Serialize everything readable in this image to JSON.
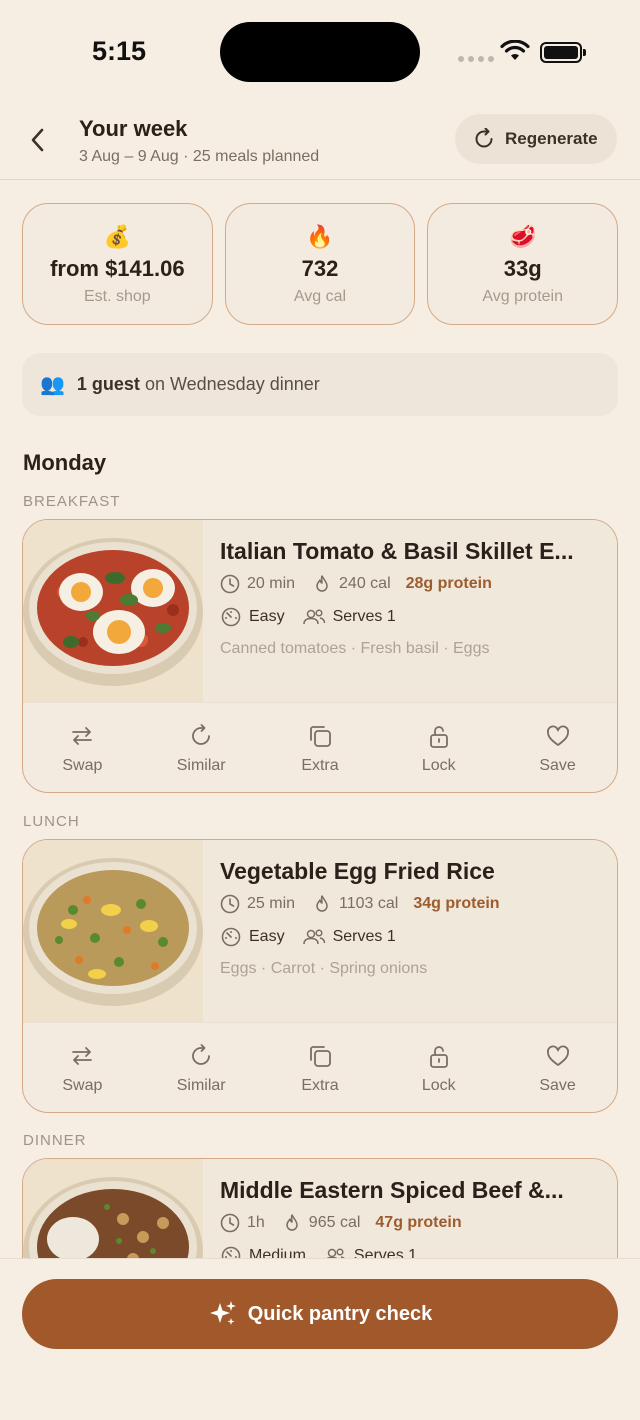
{
  "status": {
    "time": "5:15"
  },
  "header": {
    "title": "Your week",
    "subtitle": "3 Aug – 9 Aug · 25 meals planned",
    "regenerate_label": "Regenerate"
  },
  "stats": [
    {
      "icon": "💰",
      "value": "from $141.06",
      "label": "Est. shop"
    },
    {
      "icon": "🔥",
      "value": "732",
      "label": "Avg cal"
    },
    {
      "icon": "🥩",
      "value": "33g",
      "label": "Avg protein"
    }
  ],
  "guest": {
    "icon": "👥",
    "bold": "1 guest",
    "rest": "on Wednesday dinner"
  },
  "day": {
    "title": "Monday"
  },
  "meals": [
    {
      "section": "BREAKFAST",
      "name": "Italian Tomato & Basil Skillet E...",
      "time": "20 min",
      "cal": "240 cal",
      "protein": "28g protein",
      "difficulty": "Easy",
      "serves": "Serves 1",
      "ingredients": "Canned tomatoes · Fresh basil · Eggs"
    },
    {
      "section": "LUNCH",
      "name": "Vegetable Egg Fried Rice",
      "time": "25 min",
      "cal": "1103 cal",
      "protein": "34g protein",
      "difficulty": "Easy",
      "serves": "Serves 1",
      "ingredients": "Eggs · Carrot · Spring onions"
    },
    {
      "section": "DINNER",
      "name": "Middle Eastern Spiced Beef &...",
      "time": "1h",
      "cal": "965 cal",
      "protein": "47g protein",
      "difficulty": "Medium",
      "serves": "Serves 1",
      "ingredients": ""
    }
  ],
  "actions": {
    "swap": "Swap",
    "similar": "Similar",
    "extra": "Extra",
    "lock": "Lock",
    "save": "Save"
  },
  "bottom": {
    "pantry_label": "Quick pantry check"
  }
}
